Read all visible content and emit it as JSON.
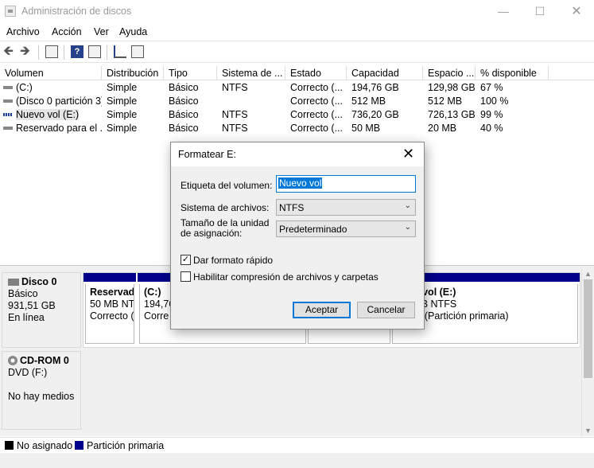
{
  "window": {
    "title": "Administración de discos"
  },
  "menu": [
    "Archivo",
    "Acción",
    "Ver",
    "Ayuda"
  ],
  "volumes": {
    "headers": [
      "Volumen",
      "Distribución",
      "Tipo",
      "Sistema de ...",
      "Estado",
      "Capacidad",
      "Espacio ...",
      "% disponible"
    ],
    "rows": [
      {
        "name": "(C:)",
        "layout": "Simple",
        "type": "Básico",
        "fs": "NTFS",
        "status": "Correcto (...",
        "capacity": "194,76 GB",
        "free": "129,98 GB",
        "pct": "67 %"
      },
      {
        "name": "(Disco 0 partición 3)",
        "layout": "Simple",
        "type": "Básico",
        "fs": "",
        "status": "Correcto (...",
        "capacity": "512 MB",
        "free": "512 MB",
        "pct": "100 %"
      },
      {
        "name": "Nuevo vol (E:)",
        "layout": "Simple",
        "type": "Básico",
        "fs": "NTFS",
        "status": "Correcto (...",
        "capacity": "736,20 GB",
        "free": "726,13 GB",
        "pct": "99 %"
      },
      {
        "name": "Reservado para el ...",
        "layout": "Simple",
        "type": "Básico",
        "fs": "NTFS",
        "status": "Correcto (...",
        "capacity": "50 MB",
        "free": "20 MB",
        "pct": "40 %"
      }
    ]
  },
  "disks": [
    {
      "name": "Disco 0",
      "type": "Básico",
      "size": "931,51 GB",
      "status": "En línea"
    },
    {
      "name": "CD-ROM 0",
      "type": "DVD (F:)",
      "size": "",
      "status": "No hay medios"
    }
  ],
  "partitions": [
    {
      "name": "Reservad",
      "line2": "50 MB NT",
      "line3": "Correcto ("
    },
    {
      "name": "(C:)",
      "line2": "194,76",
      "line3": "Corre"
    },
    {
      "name": "o vol  (E:)",
      "line2": "GB NTFS",
      "line3": "to (Partición primaria)"
    }
  ],
  "legend": {
    "unallocated": "No asignado",
    "primary": "Partición primaria"
  },
  "colors": {
    "primary_partition": "#00008b",
    "unallocated": "#000000",
    "accent": "#0078d7"
  },
  "dialog": {
    "title": "Formatear E:",
    "volume_label_label": "Etiqueta del volumen:",
    "volume_label_value": "Nuevo vol",
    "fs_label": "Sistema de archivos:",
    "fs_value": "NTFS",
    "alloc_label_1": "Tamaño de la unidad",
    "alloc_label_2": "de asignación:",
    "alloc_value": "Predeterminado",
    "quick_format": "Dar formato rápido",
    "compression": "Habilitar compresión de archivos y carpetas",
    "ok": "Aceptar",
    "cancel": "Cancelar"
  }
}
